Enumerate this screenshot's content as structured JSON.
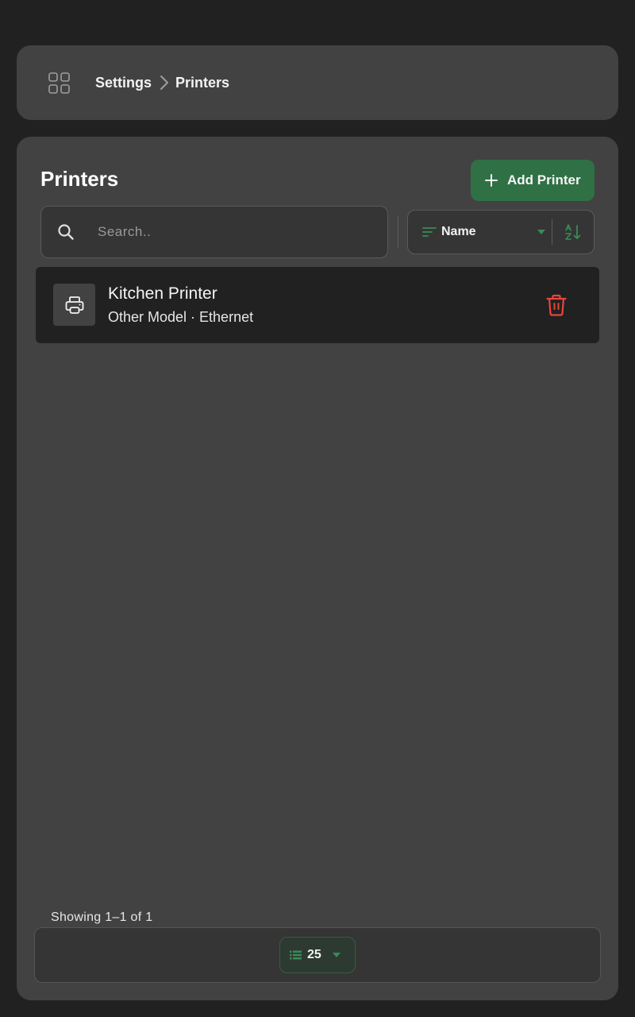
{
  "breadcrumb": {
    "items": [
      "Settings",
      "Printers"
    ]
  },
  "page": {
    "title": "Printers",
    "add_button_label": "Add Printer"
  },
  "search": {
    "placeholder": "Search..",
    "value": ""
  },
  "sort": {
    "field": "Name",
    "direction": "ascending"
  },
  "printers": [
    {
      "name": "Kitchen Printer",
      "details": "Other Model · Ethernet"
    }
  ],
  "pagination": {
    "showing_text": "Showing 1–1 of 1",
    "page_size": "25"
  },
  "colors": {
    "accent": "#2f7145",
    "accent_icon": "#3a8b57",
    "danger": "#e8453c",
    "background": "#212121",
    "surface": "#424242"
  },
  "icons": {
    "breadcrumb_menu": "apps-grid-icon",
    "breadcrumb_separator": "chevron-right-icon",
    "add": "plus-icon",
    "search": "search-icon",
    "sort": "sort-lines-icon",
    "sort_caret": "caret-down-icon",
    "sort_direction": "sort-az-icon",
    "printer": "printer-icon",
    "delete": "trash-icon",
    "page_size": "list-icon"
  }
}
